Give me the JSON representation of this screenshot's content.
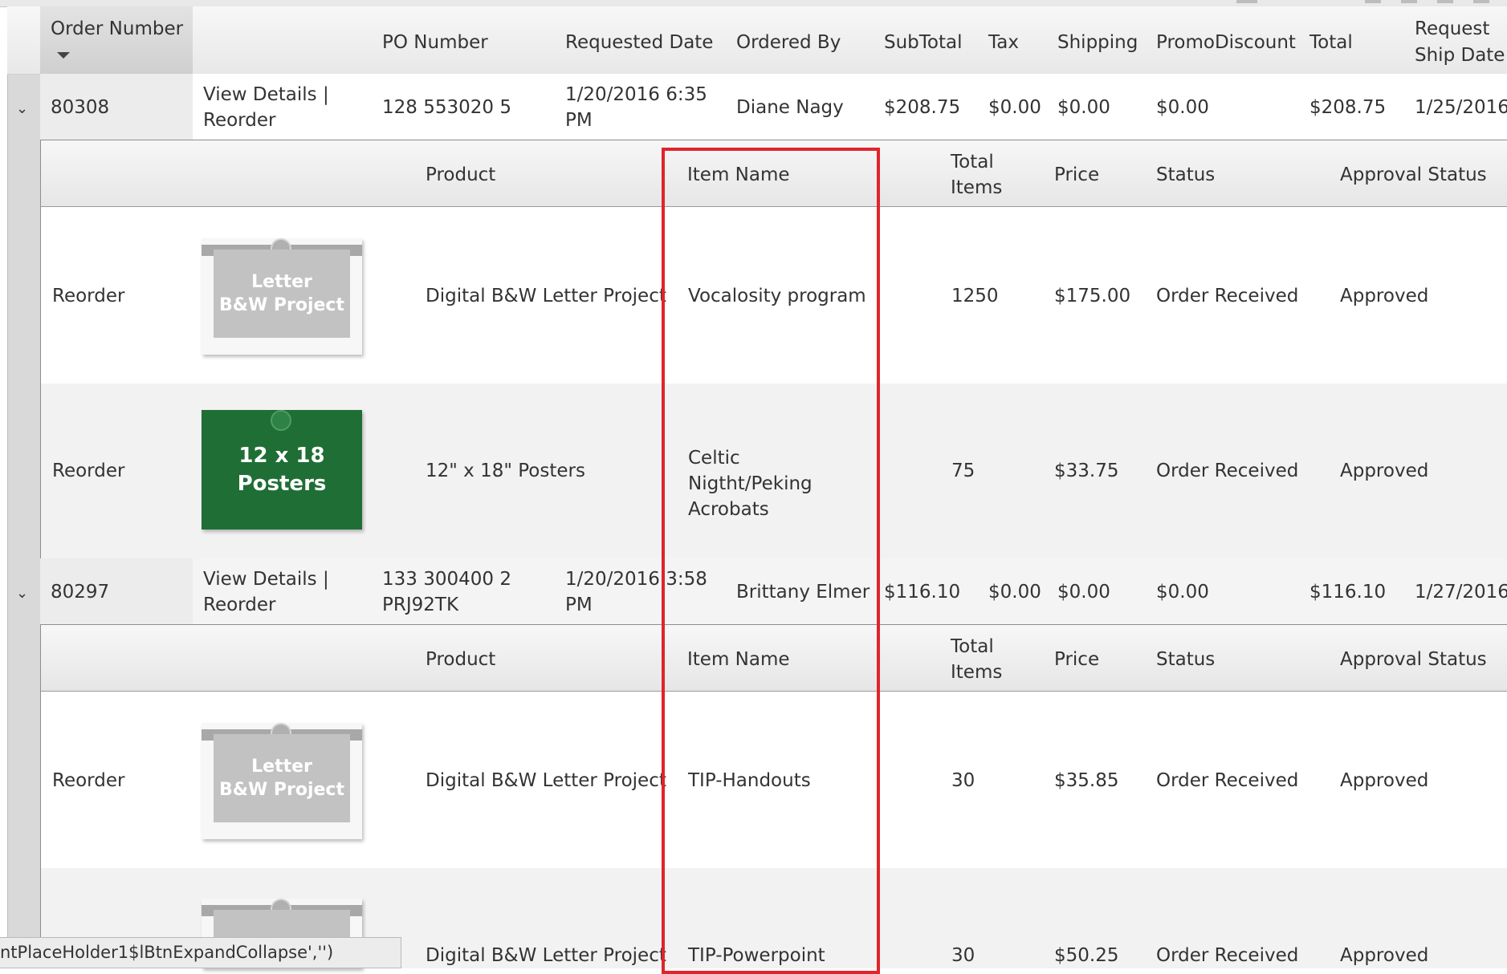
{
  "columns": {
    "order_number": "Order Number",
    "po_number": "PO Number",
    "requested_date": "Requested Date",
    "ordered_by": "Ordered By",
    "subtotal": "SubTotal",
    "tax": "Tax",
    "shipping": "Shipping",
    "promo_discount": "PromoDiscount",
    "total": "Total",
    "request_ship_date_1": "Request",
    "request_ship_date_2": "Ship Date"
  },
  "detail_columns": {
    "product": "Product",
    "item_name": "Item Name",
    "total_items_1": "Total",
    "total_items_2": "Items",
    "price": "Price",
    "status": "Status",
    "approval_status": "Approval Status"
  },
  "orders": [
    {
      "number": "80308",
      "actions_1": "View Details |",
      "actions_2": "Reorder",
      "po_1": "128 553020 5",
      "po_2": "",
      "date_1": "1/20/2016 6:35",
      "date_2": "PM",
      "ordered_by": "Diane Nagy",
      "subtotal": "$208.75",
      "tax": "$0.00",
      "shipping": "$0.00",
      "promo": "$0.00",
      "total": "$208.75",
      "ship_date": "1/25/2016",
      "items": [
        {
          "reorder": "Reorder",
          "thumb_line1": "Letter",
          "thumb_line2": "B&W Project",
          "product": "Digital B&W Letter Project",
          "item_name": "Vocalosity program",
          "total_items": "1250",
          "price": "$175.00",
          "status": "Order Received",
          "approval": "Approved"
        },
        {
          "reorder": "Reorder",
          "thumb_line1": "12 x 18",
          "thumb_line2": "Posters",
          "product": "12\" x 18\" Posters",
          "item_name": "Celtic Nigtht/Peking Acrobats",
          "total_items": "75",
          "price": "$33.75",
          "status": "Order Received",
          "approval": "Approved"
        }
      ]
    },
    {
      "number": "80297",
      "actions_1": "View Details |",
      "actions_2": "Reorder",
      "po_1": "133 300400 2",
      "po_2": "PRJ92TK",
      "date_1": "1/20/2016 3:58",
      "date_2": "PM",
      "ordered_by": "Brittany Elmer",
      "subtotal": "$116.10",
      "tax": "$0.00",
      "shipping": "$0.00",
      "promo": "$0.00",
      "total": "$116.10",
      "ship_date": "1/27/2016",
      "items": [
        {
          "reorder": "Reorder",
          "thumb_line1": "Letter",
          "thumb_line2": "B&W Project",
          "product": "Digital B&W Letter Project",
          "item_name": "TIP-Handouts",
          "total_items": "30",
          "price": "$35.85",
          "status": "Order Received",
          "approval": "Approved"
        },
        {
          "reorder": "",
          "thumb_line1": "",
          "thumb_line2": "",
          "product": "Digital B&W Letter Project",
          "item_name": "TIP-Powerpoint",
          "total_items": "30",
          "price": "$50.25",
          "status": "Order Received",
          "approval": "Approved"
        }
      ]
    }
  ],
  "status_tip": "ntPlaceHolder1$lBtnExpandCollapse','')",
  "icons": {
    "expand": "chevron-down-icon",
    "sort": "sort-desc-icon"
  },
  "colors": {
    "highlight": "#e0242b",
    "poster_green": "#1f6e35"
  }
}
